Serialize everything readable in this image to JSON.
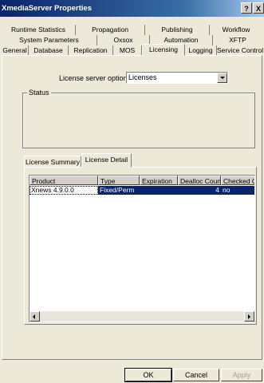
{
  "window": {
    "title": "XmediaServer Properties",
    "help_button": "?",
    "close_button": "X"
  },
  "tabs": {
    "row1": [
      "Runtime Statistics",
      "Propagation",
      "Publishing",
      "Workflow"
    ],
    "row2": [
      "System Parameters",
      "Oxsox",
      "Automation",
      "XFTP"
    ],
    "row3": [
      "General",
      "Database",
      "Replication",
      "MOS",
      "Licensing",
      "Logging",
      "Service Control"
    ],
    "active": "Licensing"
  },
  "licensing": {
    "server_option_label": "License server option:",
    "server_option_value": "Licenses",
    "status_label": "Status",
    "subtabs": [
      "License Summary",
      "License Detail"
    ],
    "active_subtab": "License Detail",
    "columns": [
      "Product",
      "Type",
      "Expiration",
      "Dealloc Count",
      "Checked Out"
    ],
    "rows": [
      {
        "product": "Xnews 4.9.0.0",
        "type": "Fixed/Perm",
        "expiration": "",
        "dealloc_count": "4",
        "checked_out": "no"
      }
    ]
  },
  "buttons": {
    "ok": "OK",
    "cancel": "Cancel",
    "apply": "Apply"
  },
  "colors": {
    "titlebar": "#0a246a",
    "selection": "#0a246a",
    "face": "#ece9d8"
  }
}
